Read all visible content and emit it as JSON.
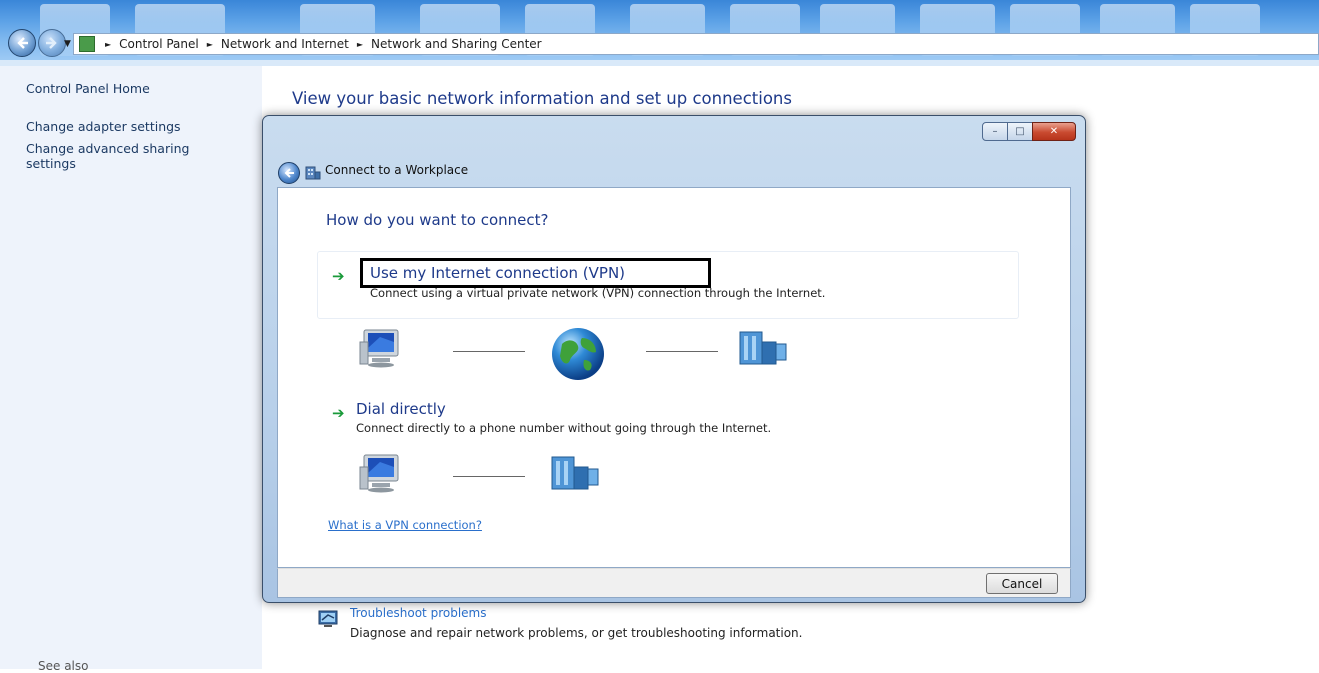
{
  "breadcrumb": {
    "items": [
      "Control Panel",
      "Network and Internet",
      "Network and Sharing Center"
    ]
  },
  "sidebar": {
    "links": [
      "Control Panel Home",
      "Change adapter settings",
      "Change advanced sharing settings"
    ],
    "see_also": "See also"
  },
  "main": {
    "title": "View your basic network information and set up connections",
    "troubleshoot": {
      "link": "Troubleshoot problems",
      "description": "Diagnose and repair network problems, or get troubleshooting information."
    }
  },
  "dialog": {
    "title": "Connect to a Workplace",
    "question": "How do you want to connect?",
    "options": [
      {
        "title": "Use my Internet connection (VPN)",
        "description": "Connect using a virtual private network (VPN) connection through the Internet."
      },
      {
        "title": "Dial directly",
        "description": "Connect directly to a phone number without going through the Internet."
      }
    ],
    "help_link": "What is a VPN connection?",
    "cancel_label": "Cancel",
    "window_buttons": {
      "minimize": "–",
      "maximize": "□",
      "close": "✕"
    }
  },
  "colors": {
    "link": "#2a6fcb",
    "heading": "#1e3a8a",
    "arrow": "#1a9a3a",
    "highlight_box": "#000000"
  },
  "icons": [
    "back-icon",
    "forward-icon",
    "network-icon",
    "computer-icon",
    "globe-icon",
    "building-icon",
    "troubleshoot-icon",
    "connect-workplace-icon"
  ]
}
